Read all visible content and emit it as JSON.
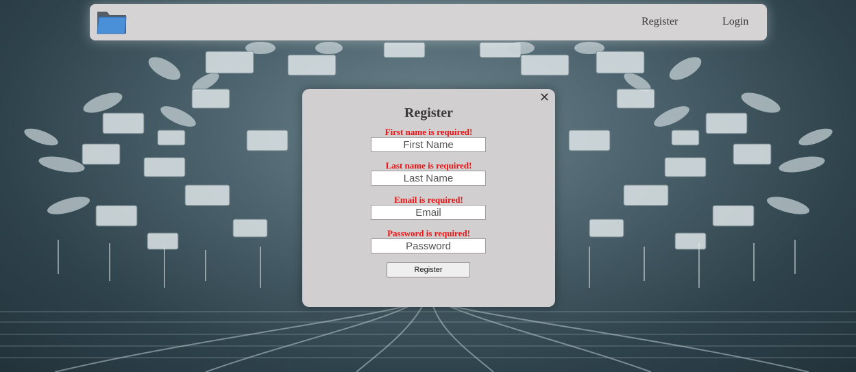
{
  "navbar": {
    "logo_icon": "folder-icon",
    "links": {
      "register": "Register",
      "login": "Login"
    }
  },
  "modal": {
    "title": "Register",
    "close_icon": "close-icon",
    "close_glyph": "✕",
    "fields": {
      "first_name": {
        "error": "First name is required!",
        "placeholder": "First Name",
        "value": ""
      },
      "last_name": {
        "error": "Last name is required!",
        "placeholder": "Last Name",
        "value": ""
      },
      "email": {
        "error": "Email is required!",
        "placeholder": "Email",
        "value": ""
      },
      "password": {
        "error": "Password is required!",
        "placeholder": "Password",
        "value": ""
      }
    },
    "submit_label": "Register"
  },
  "colors": {
    "error": "#ee1111",
    "navbar_bg": "#d6d3d4",
    "modal_bg": "#d2cfd0",
    "folder_blue": "#4a90d9"
  }
}
